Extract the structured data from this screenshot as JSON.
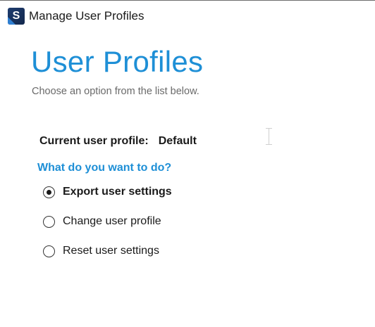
{
  "window": {
    "title": "Manage User Profiles",
    "icon": {
      "name": "app-logo-icon",
      "letter": "S"
    }
  },
  "page": {
    "heading": "User Profiles",
    "subtitle": "Choose an option from the list below."
  },
  "current_profile": {
    "label": "Current user profile:",
    "value": "Default"
  },
  "question": "What do you want to do?",
  "options": [
    {
      "label": "Export user settings",
      "selected": true
    },
    {
      "label": "Change user profile",
      "selected": false
    },
    {
      "label": "Reset user settings",
      "selected": false
    }
  ],
  "colors": {
    "accent": "#1e8fd6",
    "text": "#1a1a1a",
    "muted": "#6a6a6a"
  }
}
